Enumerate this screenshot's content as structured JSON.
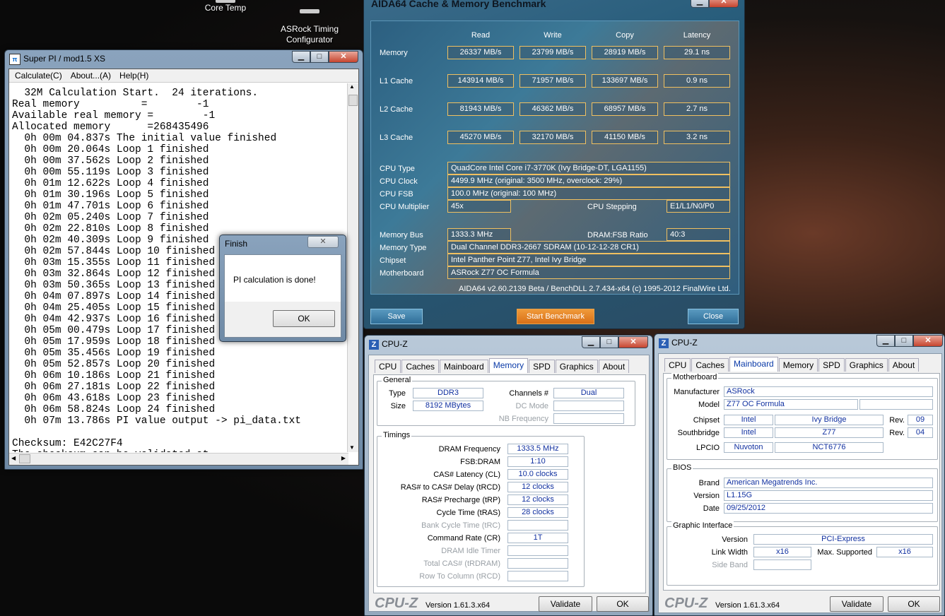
{
  "desktop": {
    "icons": [
      {
        "label": "Core Temp"
      },
      {
        "label": "ASRock Timing\nConfigurator"
      }
    ]
  },
  "superpi": {
    "title": "Super PI / mod1.5 XS",
    "menu": [
      "Calculate(C)",
      "About...(A)",
      "Help(H)"
    ],
    "log": "  32M Calculation Start.  24 iterations.\nReal memory          =        -1\nAvailable real memory =        -1\nAllocated memory      =268435496\n  0h 00m 04.837s The initial value finished\n  0h 00m 20.064s Loop 1 finished\n  0h 00m 37.562s Loop 2 finished\n  0h 00m 55.119s Loop 3 finished\n  0h 01m 12.622s Loop 4 finished\n  0h 01m 30.196s Loop 5 finished\n  0h 01m 47.701s Loop 6 finished\n  0h 02m 05.240s Loop 7 finished\n  0h 02m 22.810s Loop 8 finished\n  0h 02m 40.309s Loop 9 finished\n  0h 02m 57.844s Loop 10 finished\n  0h 03m 15.355s Loop 11 finished\n  0h 03m 32.864s Loop 12 finished\n  0h 03m 50.365s Loop 13 finished\n  0h 04m 07.897s Loop 14 finished\n  0h 04m 25.405s Loop 15 finished\n  0h 04m 42.937s Loop 16 finished\n  0h 05m 00.479s Loop 17 finished\n  0h 05m 17.959s Loop 18 finished\n  0h 05m 35.456s Loop 19 finished\n  0h 05m 52.857s Loop 20 finished\n  0h 06m 10.186s Loop 21 finished\n  0h 06m 27.181s Loop 22 finished\n  0h 06m 43.618s Loop 23 finished\n  0h 06m 58.824s Loop 24 finished\n  0h 07m 13.786s PI value output -> pi_data.txt\n\nChecksum: E42C27F4\nThe checksum can be validated at"
  },
  "finish_dialog": {
    "title": "Finish",
    "message": "PI calculation is done!",
    "ok_label": "OK"
  },
  "aida": {
    "title": "AIDA64 Cache & Memory Benchmark",
    "columns": [
      "Read",
      "Write",
      "Copy",
      "Latency"
    ],
    "rows": [
      {
        "label": "Memory",
        "read": "26337 MB/s",
        "write": "23799 MB/s",
        "copy": "28919 MB/s",
        "latency": "29.1 ns"
      },
      {
        "label": "L1 Cache",
        "read": "143914 MB/s",
        "write": "71957 MB/s",
        "copy": "133697 MB/s",
        "latency": "0.9 ns"
      },
      {
        "label": "L2 Cache",
        "read": "81943 MB/s",
        "write": "46362 MB/s",
        "copy": "68957 MB/s",
        "latency": "2.7 ns"
      },
      {
        "label": "L3 Cache",
        "read": "45270 MB/s",
        "write": "32170 MB/s",
        "copy": "41150 MB/s",
        "latency": "3.2 ns"
      }
    ],
    "info": {
      "cpu_type_label": "CPU Type",
      "cpu_type": "QuadCore Intel Core i7-3770K  (Ivy Bridge-DT, LGA1155)",
      "cpu_clock_label": "CPU Clock",
      "cpu_clock": "4499.9 MHz  (original: 3500 MHz, overclock: 29%)",
      "cpu_fsb_label": "CPU FSB",
      "cpu_fsb": "100.0 MHz  (original: 100 MHz)",
      "cpu_mult_label": "CPU Multiplier",
      "cpu_mult": "45x",
      "cpu_stepping_label": "CPU Stepping",
      "cpu_stepping": "E1/L1/N0/P0",
      "mem_bus_label": "Memory Bus",
      "mem_bus": "1333.3 MHz",
      "dram_fsb_label": "DRAM:FSB Ratio",
      "dram_fsb": "40:3",
      "mem_type_label": "Memory Type",
      "mem_type": "Dual Channel DDR3-2667 SDRAM  (10-12-12-28 CR1)",
      "chipset_label": "Chipset",
      "chipset": "Intel Panther Point Z77, Intel Ivy Bridge",
      "mobo_label": "Motherboard",
      "mobo": "ASRock Z77 OC Formula"
    },
    "footer": "AIDA64 v2.60.2139 Beta / BenchDLL 2.7.434-x64  (c) 1995-2012 FinalWire Ltd.",
    "save_label": "Save",
    "start_label": "Start Benchmark",
    "close_label": "Close"
  },
  "cpuz_mem": {
    "title": "CPU-Z",
    "tabs": [
      "CPU",
      "Caches",
      "Mainboard",
      "Memory",
      "SPD",
      "Graphics",
      "About"
    ],
    "general_title": "General",
    "type_label": "Type",
    "type": "DDR3",
    "channels_label": "Channels #",
    "channels": "Dual",
    "size_label": "Size",
    "size": "8192 MBytes",
    "dc_mode_label": "DC Mode",
    "nb_freq_label": "NB Frequency",
    "timings_title": "Timings",
    "timings": [
      {
        "label": "DRAM Frequency",
        "value": "1333.5 MHz",
        "dim": false
      },
      {
        "label": "FSB:DRAM",
        "value": "1:10",
        "dim": false
      },
      {
        "label": "CAS# Latency (CL)",
        "value": "10.0 clocks",
        "dim": false
      },
      {
        "label": "RAS# to CAS# Delay (tRCD)",
        "value": "12 clocks",
        "dim": false
      },
      {
        "label": "RAS# Precharge (tRP)",
        "value": "12 clocks",
        "dim": false
      },
      {
        "label": "Cycle Time (tRAS)",
        "value": "28 clocks",
        "dim": false
      },
      {
        "label": "Bank Cycle Time (tRC)",
        "value": "",
        "dim": true
      },
      {
        "label": "Command Rate (CR)",
        "value": "1T",
        "dim": false
      },
      {
        "label": "DRAM Idle Timer",
        "value": "",
        "dim": true
      },
      {
        "label": "Total CAS# (tRDRAM)",
        "value": "",
        "dim": true
      },
      {
        "label": "Row To Column (tRCD)",
        "value": "",
        "dim": true
      }
    ],
    "brand": "CPU-Z",
    "version": "Version 1.61.3.x64",
    "validate_label": "Validate",
    "ok_label": "OK"
  },
  "cpuz_mb": {
    "title": "CPU-Z",
    "tabs": [
      "CPU",
      "Caches",
      "Mainboard",
      "Memory",
      "SPD",
      "Graphics",
      "About"
    ],
    "mb_title": "Motherboard",
    "manufacturer_label": "Manufacturer",
    "manufacturer": "ASRock",
    "model_label": "Model",
    "model": "Z77 OC Formula",
    "chipset_label": "Chipset",
    "chipset_vendor": "Intel",
    "chipset_name": "Ivy Bridge",
    "chipset_rev_label": "Rev.",
    "chipset_rev": "09",
    "southbridge_label": "Southbridge",
    "sb_vendor": "Intel",
    "sb_name": "Z77",
    "sb_rev_label": "Rev.",
    "sb_rev": "04",
    "lpcio_label": "LPCIO",
    "lpcio_vendor": "Nuvoton",
    "lpcio_name": "NCT6776",
    "bios_title": "BIOS",
    "brand_label": "Brand",
    "bios_brand": "American Megatrends Inc.",
    "version_label": "Version",
    "bios_version": "L1.15G",
    "date_label": "Date",
    "bios_date": "09/25/2012",
    "gi_title": "Graphic Interface",
    "gi_version_label": "Version",
    "gi_version": "PCI-Express",
    "link_width_label": "Link Width",
    "link_width": "x16",
    "max_supported_label": "Max. Supported",
    "max_supported": "x16",
    "side_band_label": "Side Band",
    "brand": "CPU-Z",
    "version": "Version 1.61.3.x64",
    "validate_label": "Validate",
    "ok_label": "OK"
  }
}
